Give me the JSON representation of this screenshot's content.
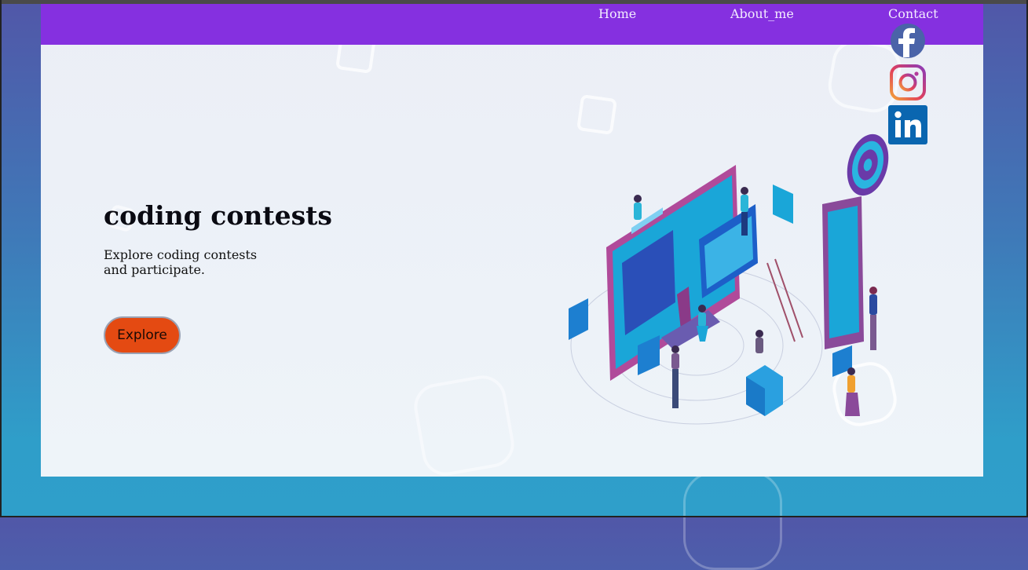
{
  "nav": {
    "home": "Home",
    "about": "About_me",
    "contact": "Contact"
  },
  "hero": {
    "title": "coding contests",
    "description": "Explore coding contests and participate.",
    "button_label": "Explore"
  },
  "social": {
    "facebook_icon": "facebook-icon",
    "instagram_icon": "instagram-icon",
    "linkedin_icon": "linkedin-icon"
  },
  "colors": {
    "navbar": "#8530e0",
    "button": "#e44a12",
    "background_top": "#5157a8",
    "background_bottom": "#2f9fca",
    "facebook": "#4a63a8",
    "linkedin": "#0a66b0"
  }
}
